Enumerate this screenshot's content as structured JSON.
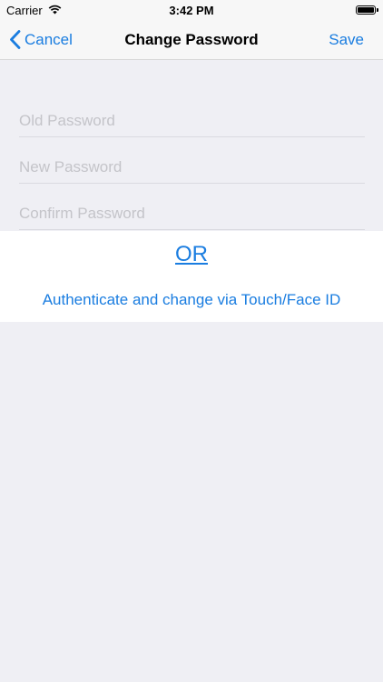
{
  "status_bar": {
    "carrier": "Carrier",
    "time": "3:42 PM",
    "battery_level": 1.0
  },
  "nav": {
    "back_label": "Cancel",
    "title": "Change Password",
    "save_label": "Save"
  },
  "form": {
    "old_password_placeholder": "Old Password",
    "new_password_placeholder": "New Password",
    "confirm_password_placeholder": "Confirm Password"
  },
  "alternative": {
    "or_label": "OR",
    "auth_label": "Authenticate and change via Touch/Face ID"
  },
  "colors": {
    "accent": "#1a7de0",
    "background": "#efeff4",
    "bar": "#f7f7f7"
  }
}
